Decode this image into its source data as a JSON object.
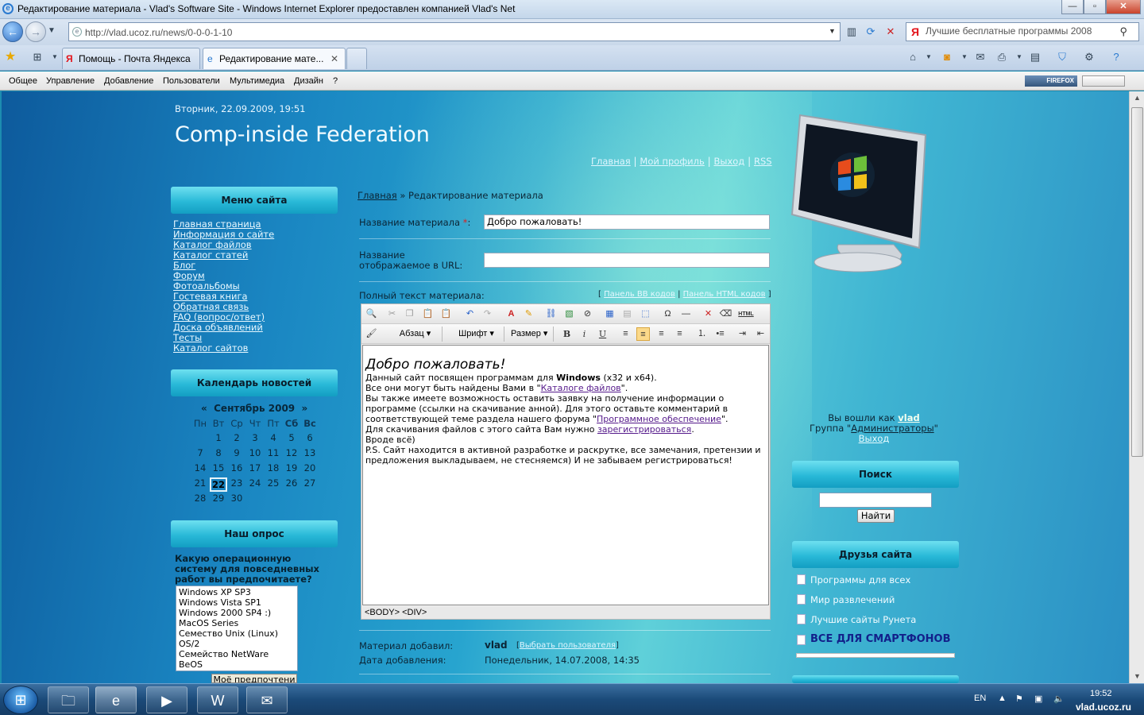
{
  "window": {
    "title": "Редактирование материала - Vlad's Software Site - Windows Internet Explorer предоставлен компанией Vlad's Net",
    "min": "—",
    "max": "▫",
    "close": "✕"
  },
  "browser": {
    "url": "http://vlad.ucoz.ru/news/0-0-0-1-10",
    "search_value": "Лучшие бесплатные программы 2008",
    "tabs": [
      "Помощь - Почта Яндекса",
      "Редактирование мате..."
    ],
    "tab_close": "✕"
  },
  "ucoz_bar": {
    "items": [
      "Общее",
      "Управление",
      "Добавление",
      "Пользователи",
      "Мультимедиа",
      "Дизайн",
      "?"
    ],
    "firefox_badge": "FIREFOX"
  },
  "site": {
    "date": "Вторник, 22.09.2009, 19:51",
    "title": "Comp-inside Federation",
    "top_links": [
      "Главная",
      "Мой профиль",
      "Выход",
      "RSS"
    ],
    "sep": "|"
  },
  "left": {
    "menu_title": "Меню сайта",
    "menu": [
      "Главная страница",
      "Информация о сайте",
      "Каталог файлов",
      "Каталог статей",
      "Блог",
      "Форум",
      "Фотоальбомы",
      "Гостевая книга",
      "Обратная связь",
      "FAQ (вопрос/ответ)",
      "Доска объявлений",
      "Тесты",
      "Каталог сайтов"
    ],
    "calendar_title": "Календарь новостей",
    "calendar": {
      "prev": "«",
      "month": "Сентябрь 2009",
      "next": "»",
      "weekdays": [
        "Пн",
        "Вт",
        "Ср",
        "Чт",
        "Пт",
        "Сб",
        "Вс"
      ],
      "weeks": [
        [
          "",
          "1",
          "2",
          "3",
          "4",
          "5",
          "6"
        ],
        [
          "7",
          "8",
          "9",
          "10",
          "11",
          "12",
          "13"
        ],
        [
          "14",
          "15",
          "16",
          "17",
          "18",
          "19",
          "20"
        ],
        [
          "21",
          "22",
          "23",
          "24",
          "25",
          "26",
          "27"
        ],
        [
          "28",
          "29",
          "30",
          "",
          "",
          "",
          ""
        ]
      ],
      "today": "22"
    },
    "poll_title": "Наш опрос",
    "poll_question": "Какую операционную систему для повседневных работ вы предпочитаете?",
    "poll_options": [
      "Windows XP SP3",
      "Windows Vista SP1",
      "Windows 2000 SP4 :)",
      "MacOS Series",
      "Семество Unix (Linux)",
      "OS/2",
      "Семейство NetWare",
      "BeOS"
    ],
    "poll_button": "Моё предпочтени"
  },
  "center": {
    "breadcrumb_home": "Главная",
    "breadcrumb_sep": "»",
    "breadcrumb_current": "Редактирование материала",
    "label_name": "Название материала",
    "required_mark": "*",
    "colon": ":",
    "name_value": "Добро пожаловать!",
    "label_url": "Название отображаемое в URL:",
    "url_value": "",
    "label_fulltext": "Полный текст материала:",
    "panel_bb": "Панель BB кодов",
    "panel_html": "Панель HTML кодов",
    "bracket_open": "[",
    "bracket_close": "]",
    "editor": {
      "format": "Абзац",
      "font": "Шрифт",
      "size": "Размер",
      "html_button": "HTML",
      "heading": "Добро пожаловать!",
      "p1_a": "Данный сайт посвящен программам для ",
      "p1_b": "Windows",
      "p1_c": " (x32 и x64).",
      "p2_a": "Все они могут быть найдены Вами в \"",
      "p2_link": "Каталоге файлов",
      "p2_c": "\".",
      "p3_a": "Вы также имеете возможность оставить заявку на получение информации о программе (ссылки на скачивание анной). Для этого оставьте комментарий в соответствующей теме раздела нашего форума \"",
      "p3_link": "Программное обеспечение",
      "p3_c": "\".",
      "p4_a": "Для скачивания файлов с этого сайта Вам нужно ",
      "p4_link": "зарегистрироваться",
      "p4_c": ".",
      "p5": "Вроде всё)",
      "p6": "P.S. Сайт находится в активной разработке и раскрутке, все замечания, претензии и предложения выкладываем, не стесняемся) И не забываем регистрироваться!",
      "status": "<BODY>  <DIV>"
    },
    "added_by_label": "Материал добавил:",
    "added_by_value": "vlad",
    "choose_user": "Выбрать пользователя",
    "date_label": "Дата добавления:",
    "date_value": "Понедельник, 14.07.2008, 14:35"
  },
  "right": {
    "logged_as": "Вы вошли как",
    "user": "vlad",
    "group_label": "Группа \"",
    "group": "Администраторы",
    "group_end": "\"",
    "logout": "Выход",
    "search_title": "Поиск",
    "search_button": "Найти",
    "friends_title": "Друзья сайта",
    "friends": [
      "Программы для всех",
      "Мир развлечений",
      "Лучшие сайты Рунета"
    ],
    "banner": "ВСЕ ДЛЯ СМАРТФОНОВ"
  },
  "taskbar": {
    "lang": "EN",
    "time": "19:52",
    "watermark": "vlad.ucoz.ru"
  }
}
